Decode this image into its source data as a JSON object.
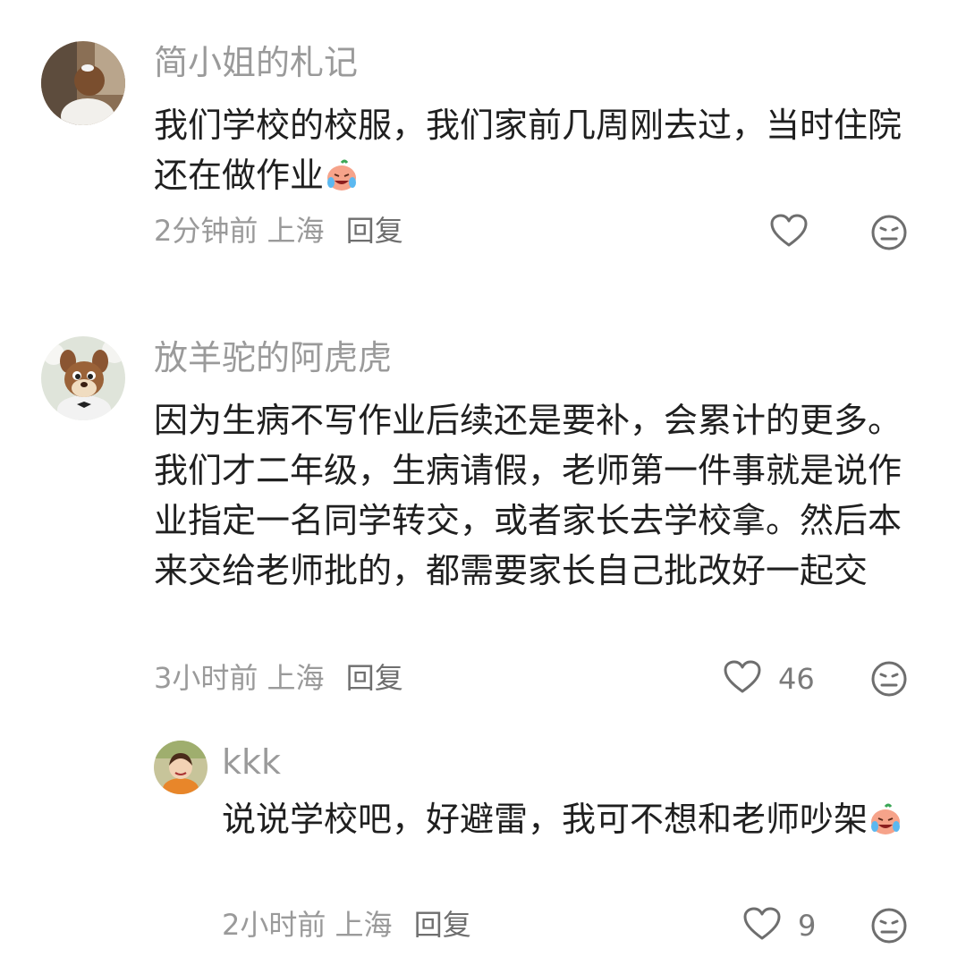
{
  "comments": [
    {
      "name": "简小姐的札记",
      "text": "我们学校的校服，我们家前几周刚去过，当时住院还在做作业",
      "emoji": "cry-laugh-emoji",
      "time": "2分钟前",
      "location": "上海",
      "reply": "回复",
      "likes": ""
    },
    {
      "name": "放羊驼的阿虎虎",
      "text": "因为生病不写作业后续还是要补，会累计的更多。我们才二年级，生病请假，老师第一件事就是说作业指定一名同学转交，或者家长去学校拿。然后本来交给老师批的，都需要家长自己批改好一起交",
      "time": "3小时前",
      "location": "上海",
      "reply": "回复",
      "likes": "46"
    },
    {
      "name": "kkk",
      "text": "说说学校吧，好避雷，我可不想和老师吵架",
      "emoji": "cry-laugh-emoji",
      "time": "2小时前",
      "location": "上海",
      "reply": "回复",
      "likes": "9"
    }
  ],
  "icons": {
    "like": "heart-outline-icon",
    "dislike": "meh-face-icon"
  },
  "colors": {
    "text": "#1f1f1f",
    "meta": "#9a9a9a",
    "icon": "#6e6e6e"
  }
}
